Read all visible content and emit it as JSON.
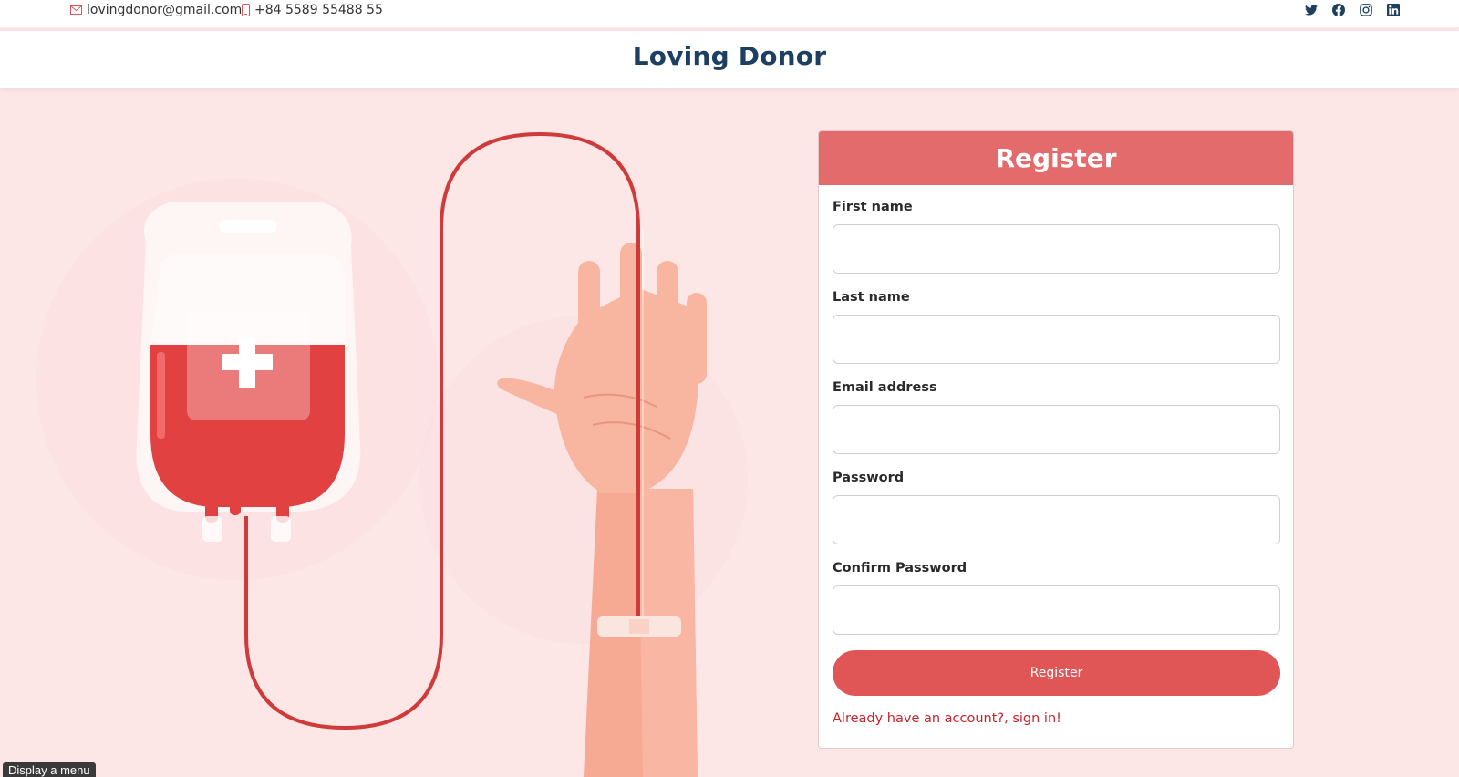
{
  "topbar": {
    "email": "lovingdonor@gmail.com",
    "phone": "+84 5589 55488 55",
    "socials": [
      "twitter-icon",
      "facebook-icon",
      "instagram-icon",
      "linkedin-icon"
    ]
  },
  "header": {
    "brand": "Loving Donor"
  },
  "register_form": {
    "title": "Register",
    "fields": [
      {
        "label": "First name",
        "value": "",
        "placeholder": ""
      },
      {
        "label": "Last name",
        "value": "",
        "placeholder": ""
      },
      {
        "label": "Email address",
        "value": "",
        "placeholder": ""
      },
      {
        "label": "Password",
        "value": "",
        "placeholder": ""
      },
      {
        "label": "Confirm Password",
        "value": "",
        "placeholder": ""
      }
    ],
    "submit_label": "Register",
    "signin_link": "Already have an account?, sign in!"
  },
  "tooltip": {
    "text": "Display a menu"
  },
  "colors": {
    "accent": "#e36b6b",
    "button": "#e05555",
    "brand_text": "#1d3f61",
    "link": "#c8222b",
    "hero_background": "#fde6e6"
  }
}
